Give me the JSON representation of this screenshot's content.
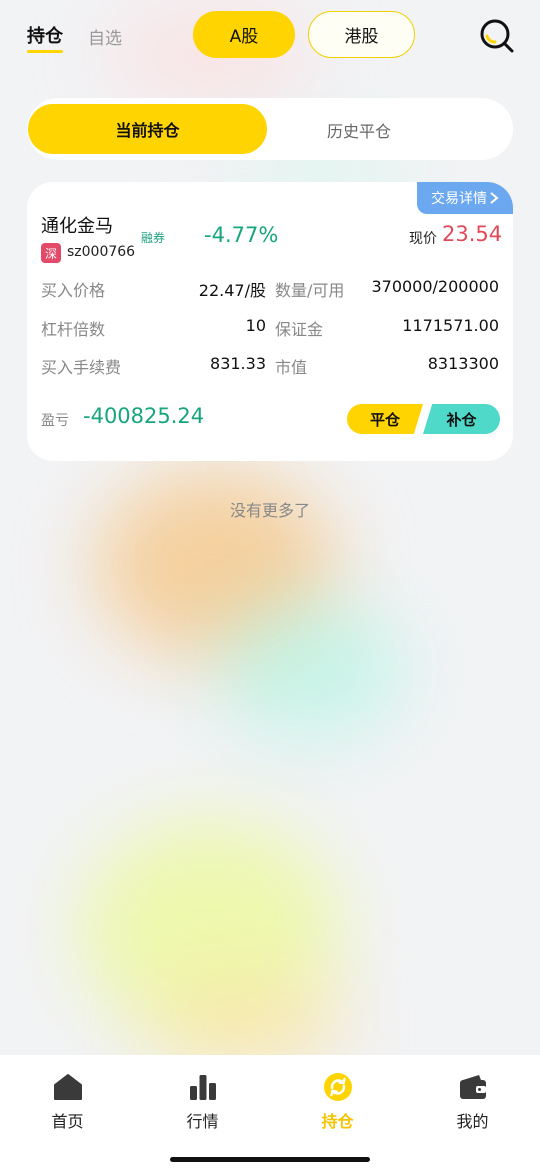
{
  "header": {
    "tab_holdings": "持仓",
    "tab_watchlist": "自选",
    "market_a": "A股",
    "market_hk": "港股",
    "search_icon": "search-icon"
  },
  "segment": {
    "current": "当前持仓",
    "history": "历史平仓"
  },
  "position": {
    "trade_detail": "交易详情",
    "name": "通化金马",
    "exchange_badge": "深",
    "code": "sz000766",
    "margin_tag": "融券",
    "change": "-4.77%",
    "price_label": "现价",
    "price": "23.54",
    "fields": {
      "buy_price_label": "买入价格",
      "buy_price": "22.47/股",
      "quantity_label": "数量/可用",
      "quantity": "370000/200000",
      "leverage_label": "杠杆倍数",
      "leverage": "10",
      "deposit_label": "保证金",
      "deposit": "1171571.00",
      "fee_label": "买入手续费",
      "fee": "831.33",
      "market_value_label": "市值",
      "market_value": "8313300"
    },
    "pnl_label": "盈亏",
    "pnl": "-400825.24",
    "close_button": "平仓",
    "add_button": "补仓"
  },
  "no_more": "没有更多了",
  "nav": [
    {
      "label": "首页",
      "icon": "home-icon"
    },
    {
      "label": "行情",
      "icon": "bar-chart-icon"
    },
    {
      "label": "持仓",
      "icon": "refresh-circle-icon",
      "active": true
    },
    {
      "label": "我的",
      "icon": "wallet-icon"
    }
  ],
  "colors": {
    "accent": "#ffd400",
    "gain_down": "#17a57e",
    "price_up": "#e04a5a",
    "detail_blue": "#6ca8f0",
    "add_teal": "#4ed9c9"
  }
}
